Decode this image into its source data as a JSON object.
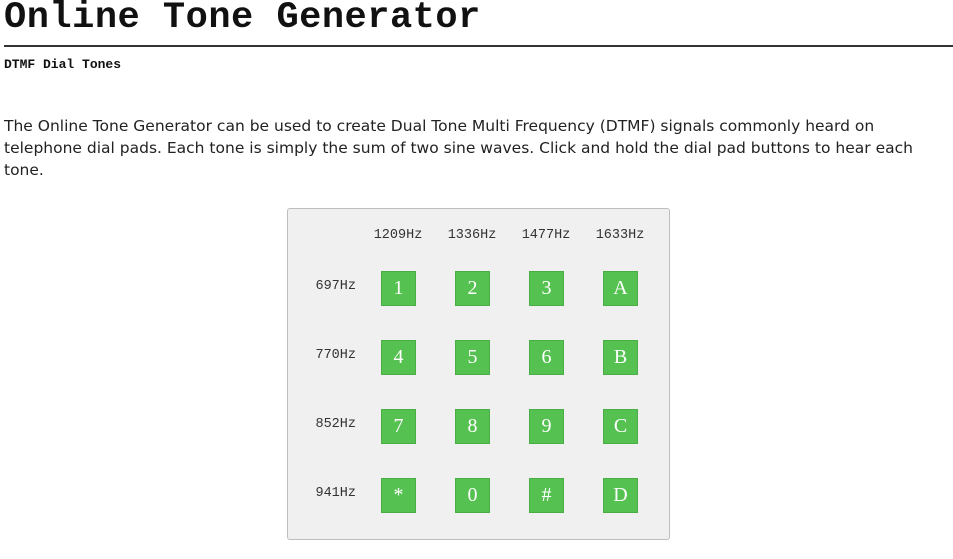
{
  "header": {
    "title": "Online Tone Generator",
    "subtitle": "DTMF Dial Tones"
  },
  "intro": {
    "text": "The Online Tone Generator can be used to create Dual Tone Multi Frequency (DTMF) signals commonly heard on telephone dial pads. Each tone is simply the sum of two sine waves. Click and hold the dial pad buttons to hear each tone."
  },
  "dialpad": {
    "column_frequencies": [
      "1209Hz",
      "1336Hz",
      "1477Hz",
      "1633Hz"
    ],
    "row_frequencies": [
      "697Hz",
      "770Hz",
      "852Hz",
      "941Hz"
    ],
    "keys": [
      [
        "1",
        "2",
        "3",
        "A"
      ],
      [
        "4",
        "5",
        "6",
        "B"
      ],
      [
        "7",
        "8",
        "9",
        "C"
      ],
      [
        "*",
        "0",
        "#",
        "D"
      ]
    ],
    "colors": {
      "key_background": "#55c150",
      "key_text": "#ffffff",
      "panel_background": "#f0f0f0"
    }
  }
}
